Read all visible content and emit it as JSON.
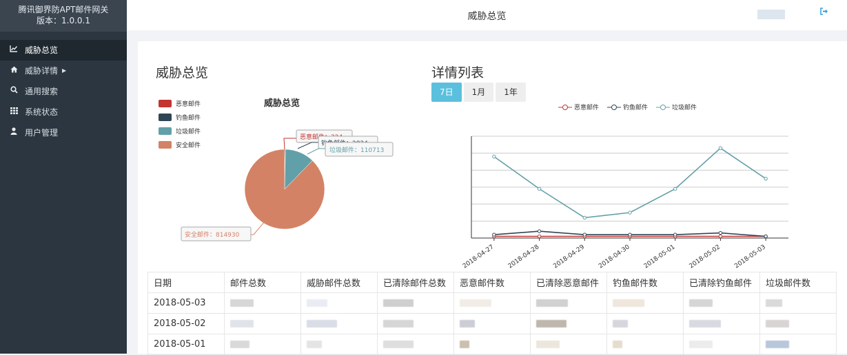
{
  "sidebar": {
    "brand_line1": "腾讯御界防APT邮件网关",
    "brand_line2": "版本：1.0.0.1",
    "items": [
      {
        "label": "威胁总览",
        "icon": "line-chart-icon",
        "glyph": "📈"
      },
      {
        "label": "威胁详情",
        "icon": "home-icon",
        "glyph": "🏠"
      },
      {
        "label": "通用搜索",
        "icon": "search-icon",
        "glyph": "🔍"
      },
      {
        "label": "系统状态",
        "icon": "grid-icon",
        "glyph": "▦"
      },
      {
        "label": "用户管理",
        "icon": "user-icon",
        "glyph": "👤"
      }
    ]
  },
  "header": {
    "title": "威胁总览",
    "logout_icon": "sign-out-icon"
  },
  "overview": {
    "title": "威胁总览",
    "pie_title": "威胁总览",
    "legend": [
      {
        "name": "恶意邮件",
        "color": "#c23531"
      },
      {
        "name": "钓鱼邮件",
        "color": "#2f4554"
      },
      {
        "name": "垃圾邮件",
        "color": "#61a0a8"
      },
      {
        "name": "安全邮件",
        "color": "#d48265"
      }
    ],
    "callouts": {
      "malicious": "恶意邮件：324",
      "phishing": "钓鱼邮件：2824",
      "spam": "垃圾邮件：110713",
      "safe": "安全邮件：814930"
    }
  },
  "details": {
    "title": "详情列表",
    "ranges": [
      "7日",
      "1月",
      "1年"
    ],
    "line_legend": [
      "恶意邮件",
      "钓鱼邮件",
      "垃圾邮件"
    ]
  },
  "table": {
    "headers": [
      "日期",
      "邮件总数",
      "威胁邮件总数",
      "已清除邮件总数",
      "恶意邮件数",
      "已清除恶意邮件",
      "钓鱼邮件数",
      "已清除钓鱼邮件",
      "垃圾邮件数"
    ],
    "rows": [
      {
        "date": "2018-05-03"
      },
      {
        "date": "2018-05-02"
      },
      {
        "date": "2018-05-01"
      }
    ]
  },
  "chart_data": [
    {
      "type": "pie",
      "title": "威胁总览",
      "series": [
        {
          "name": "",
          "values": [
            {
              "name": "恶意邮件",
              "value": 324
            },
            {
              "name": "钓鱼邮件",
              "value": 2824
            },
            {
              "name": "垃圾邮件",
              "value": 110713
            },
            {
              "name": "安全邮件",
              "value": 814930
            }
          ]
        }
      ],
      "legend_position": "top-left"
    },
    {
      "type": "line",
      "x": [
        "2018-04-27",
        "2018-04-28",
        "2018-04-29",
        "2018-04-30",
        "2018-05-01",
        "2018-05-02",
        "2018-05-03"
      ],
      "series": [
        {
          "name": "恶意邮件",
          "color": "#c23531",
          "values": [
            1,
            1,
            1,
            1,
            1,
            1,
            1
          ]
        },
        {
          "name": "钓鱼邮件",
          "color": "#2f4554",
          "values": [
            2,
            4,
            2,
            2,
            2,
            3,
            1
          ]
        },
        {
          "name": "垃圾邮件",
          "color": "#61a0a8",
          "values": [
            48,
            29,
            12,
            15,
            29,
            53,
            35
          ]
        }
      ],
      "ylim": [
        0,
        60
      ],
      "grid": true,
      "legend_position": "top-center"
    }
  ]
}
